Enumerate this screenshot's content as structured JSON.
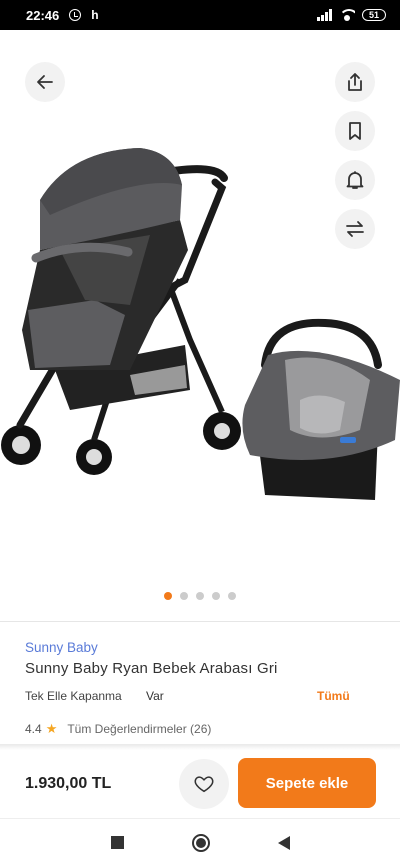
{
  "status_bar": {
    "time": "22:46",
    "indicator": "h",
    "battery": "51"
  },
  "top_actions": {
    "back_icon": "arrow-left-icon",
    "share_icon": "share-icon",
    "bookmark_icon": "bookmark-icon",
    "notify_icon": "bell-icon",
    "compare_icon": "compare-arrows-icon"
  },
  "gallery": {
    "total_images": 5,
    "active_index": 0
  },
  "product": {
    "brand": "Sunny Baby",
    "title": "Sunny Baby Ryan Bebek Arabası Gri",
    "feature": {
      "label": "Tek Elle Kapanma",
      "value": "Var",
      "all_label": "Tümü"
    },
    "rating": {
      "score": "4.4",
      "reviews_label": "Tüm Değerlendirmeler (26)"
    }
  },
  "purchase": {
    "price": "1.930,00 TL",
    "favorite_icon": "heart-icon",
    "add_to_cart_label": "Sepete ekle"
  },
  "colors": {
    "accent": "#f27a1a",
    "brand_link": "#5a7bd8",
    "star": "#f5a623"
  }
}
